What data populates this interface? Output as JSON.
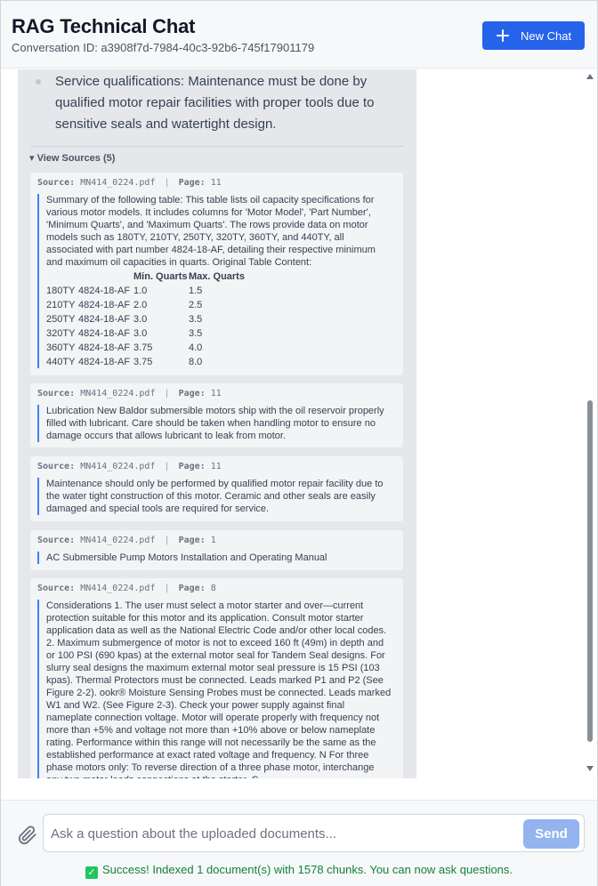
{
  "header": {
    "title": "RAG Technical Chat",
    "conversation_id": "Conversation ID: a3908f7d-7984-40c3-92b6-745f17901179",
    "new_chat_label": "New Chat"
  },
  "message": {
    "bullet_text": "Service qualifications: Maintenance must be done by qualified motor repair facilities with proper tools due to sensitive seals and watertight design.",
    "sources_toggle": "▾ View Sources (5)"
  },
  "source_labels": {
    "source": "Source:",
    "page": "Page:"
  },
  "sources": [
    {
      "file": "MN414_0224.pdf",
      "page": "11",
      "text": "Summary of the following table: This table lists oil capacity specifications for various motor models. It includes columns for 'Motor Model', 'Part Number', 'Minimum Quarts', and 'Maximum Quarts'. The rows provide data on motor models such as 180TY, 210TY, 250TY, 320TY, 360TY, and 440TY, all associated with part number 4824-18-AF, detailing their respective minimum and maximum oil capacities in quarts. Original Table Content:",
      "table": {
        "headers": [
          "",
          "",
          "Min. Quarts",
          "Max. Quarts"
        ],
        "rows": [
          [
            "180TY",
            "4824-18-AF",
            "1.0",
            "1.5"
          ],
          [
            "210TY",
            "4824-18-AF",
            "2.0",
            "2.5"
          ],
          [
            "250TY",
            "4824-18-AF",
            "3.0",
            "3.5"
          ],
          [
            "320TY",
            "4824-18-AF",
            "3.0",
            "3.5"
          ],
          [
            "360TY",
            "4824-18-AF",
            "3.75",
            "4.0"
          ],
          [
            "440TY",
            "4824-18-AF",
            "3.75",
            "8.0"
          ]
        ]
      }
    },
    {
      "file": "MN414_0224.pdf",
      "page": "11",
      "text": "Lubrication New Baldor submersible motors ship with the oil reservoir properly filled with lubricant. Care should be taken when handling motor to ensure no damage occurs that allows lubricant to leak from motor."
    },
    {
      "file": "MN414_0224.pdf",
      "page": "11",
      "text": "Maintenance should only be performed by qualified motor repair facility due to the water tight construction of this motor. Ceramic and other seals are easily damaged and special tools are required for service."
    },
    {
      "file": "MN414_0224.pdf",
      "page": "1",
      "text": "AC Submersible Pump Motors Installation and Operating Manual"
    },
    {
      "file": "MN414_0224.pdf",
      "page": "8",
      "text": "Considerations 1. The user must select a motor starter and over—current protection suitable for this motor and its application. Consult motor starter application data as well as the National Electric Code and/or other local codes. 2. Maximum submergence of motor is not to exceed 160 ft (49m) in depth and or 100 PSI (690 kpas) at the external motor seal for Tandem Seal designs. For slurry seal designs the maximum external motor seal pressure is 15 PSI (103 kpas). Thermal Protectors must be connected. Leads marked P1 and P2 (See Figure 2-2). ookr® Moisture Sensing Probes must be connected. Leads marked W1 and W2. (See Figure 2-3). Check your power supply against final nameplate connection voltage. Motor will operate properly with frequency not more than +5% and voltage not more than +10% above or below nameplate rating. Performance within this range will not necessarily be the same as the established performance at exact rated voltage and frequency. N For three phase motors only: To reverse direction of a three phase motor, interchange any two motor leads connections at the starter. C"
    }
  ],
  "composer": {
    "placeholder": "Ask a question about the uploaded documents...",
    "send_label": "Send"
  },
  "status": {
    "icon": "check-icon",
    "text": "Success! Indexed 1 document(s) with 1578 chunks. You can now ask questions."
  },
  "colors": {
    "accent": "#2563eb",
    "send_disabled": "#93b4ef",
    "success": "#15803d",
    "quote_bar": "#3b82f6"
  }
}
